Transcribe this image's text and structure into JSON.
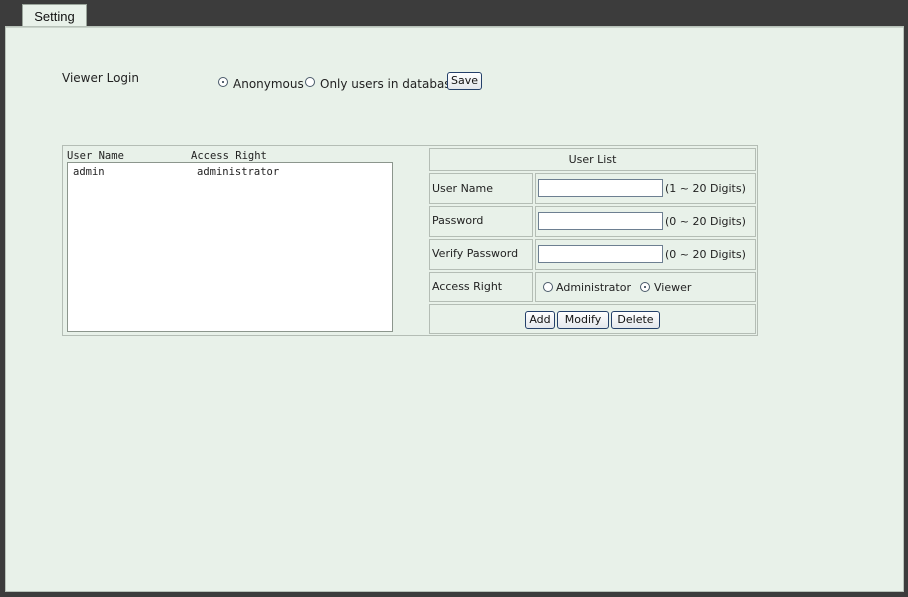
{
  "tab": {
    "label": "Setting"
  },
  "viewer_login": {
    "label": "Viewer Login",
    "options": [
      {
        "label": "Anonymous",
        "selected": true
      },
      {
        "label": "Only users in database",
        "selected": false
      }
    ],
    "save_label": "Save"
  },
  "user_table": {
    "columns": [
      "User Name",
      "Access Right"
    ],
    "rows": [
      {
        "user": "admin",
        "right": "administrator"
      }
    ]
  },
  "user_list": {
    "title": "User List",
    "fields": [
      {
        "label": "User Name",
        "value": "",
        "hint": "(1 ~ 20 Digits)"
      },
      {
        "label": "Password",
        "value": "",
        "hint": "(0 ~ 20 Digits)"
      },
      {
        "label": "Verify Password",
        "value": "",
        "hint": "(0 ~ 20 Digits)"
      }
    ],
    "access_right": {
      "label": "Access Right",
      "options": [
        {
          "label": "Administrator",
          "selected": false
        },
        {
          "label": "Viewer",
          "selected": true
        }
      ]
    },
    "buttons": {
      "add": "Add",
      "modify": "Modify",
      "delete": "Delete"
    }
  },
  "colors": {
    "background": "#e8f1e9",
    "frame": "#3c3c3c",
    "button_border": "#24406a"
  }
}
